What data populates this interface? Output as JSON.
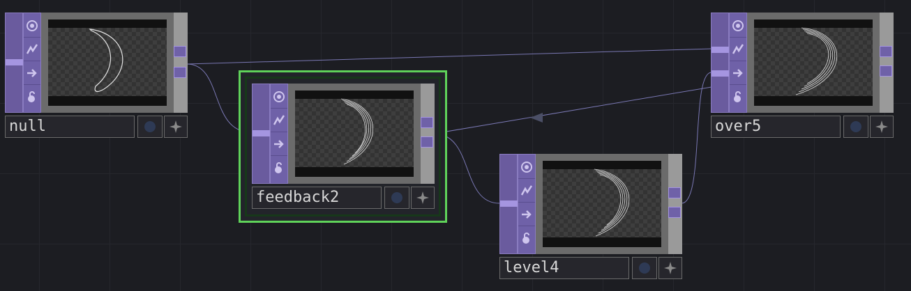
{
  "nodes": {
    "null": {
      "name": "null"
    },
    "feedback": {
      "name": "feedback2"
    },
    "level": {
      "name": "level4"
    },
    "over": {
      "name": "over5"
    }
  },
  "colors": {
    "background": "#1c1d22",
    "wire": "#7a78b4",
    "selection": "#5fd35a",
    "operator_strip": "#6f61a8"
  },
  "icons": [
    "viewer-toggle-icon",
    "cook-icon",
    "bypass-arrow-icon",
    "lock-icon",
    "display-dot-icon",
    "pin-star-icon",
    "arrowhead-icon"
  ]
}
